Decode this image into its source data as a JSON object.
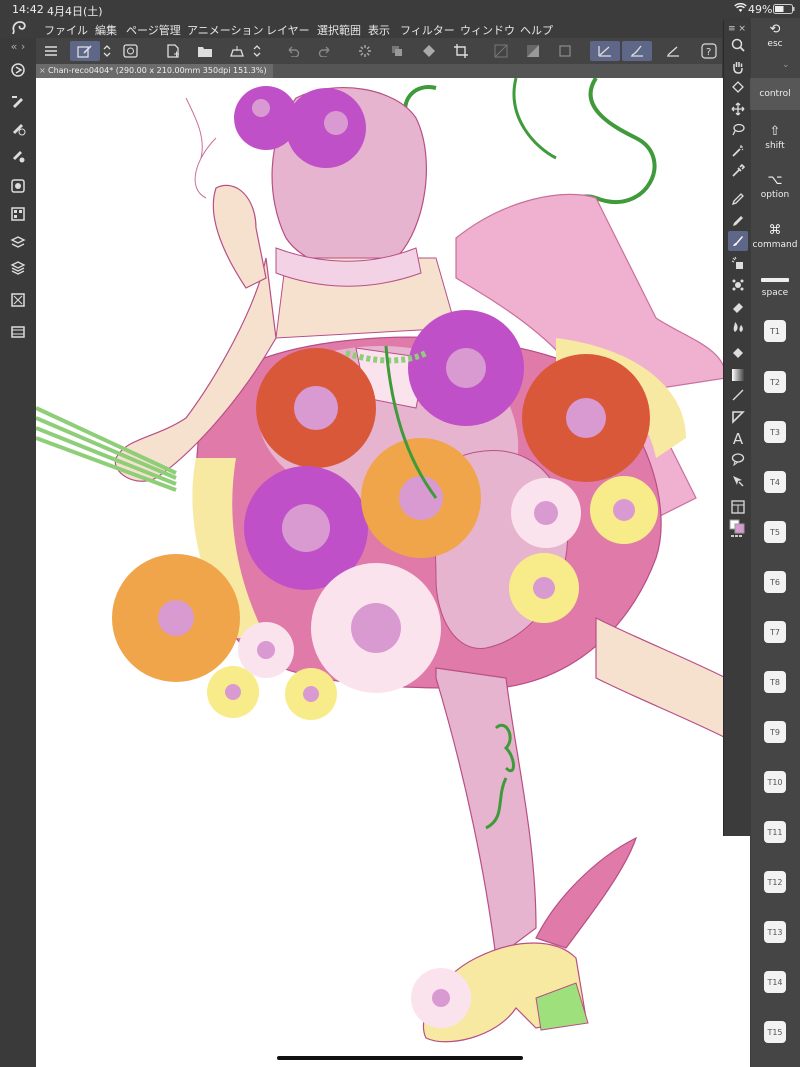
{
  "status_bar": {
    "time": "14:42",
    "date": "4月4日(土)",
    "battery": "49%"
  },
  "menu": [
    "ファイル",
    "編集",
    "ページ管理",
    "アニメーション",
    "レイヤー",
    "選択範囲",
    "表示",
    "フィルター",
    "ウィンドウ",
    "ヘルプ"
  ],
  "document_tab": {
    "title": "Chan-reco0404* (290.00 x 210.00mm 350dpi 151.3%)"
  },
  "modifier_keys": [
    {
      "label": "esc",
      "icon": "undo-arrow-icon"
    },
    {
      "label": "control",
      "icon": ""
    },
    {
      "label": "shift",
      "icon": "shift-arrow-icon"
    },
    {
      "label": "option",
      "icon": "option-key-icon"
    },
    {
      "label": "command",
      "icon": "command-key-icon"
    },
    {
      "label": "space",
      "icon": "space-bar-icon"
    }
  ],
  "tool_keys": [
    "T1",
    "T2",
    "T3",
    "T4",
    "T5",
    "T6",
    "T7",
    "T8",
    "T9",
    "T10",
    "T11",
    "T12",
    "T13",
    "T14",
    "T15"
  ],
  "palette_tools": [
    "zoom",
    "hand",
    "rotate",
    "move",
    "lasso",
    "magic-wand",
    "eyedropper",
    "pen",
    "pencil",
    "brush",
    "airbrush",
    "decoration",
    "eraser",
    "blend",
    "fill",
    "gradient",
    "line",
    "figure",
    "text",
    "balloon",
    "operation",
    "frame-border",
    "color-swatch"
  ],
  "colors": {
    "accent": "#5e6788",
    "ui_dark": "#3a3a3a",
    "canvas": "#ffffff"
  }
}
